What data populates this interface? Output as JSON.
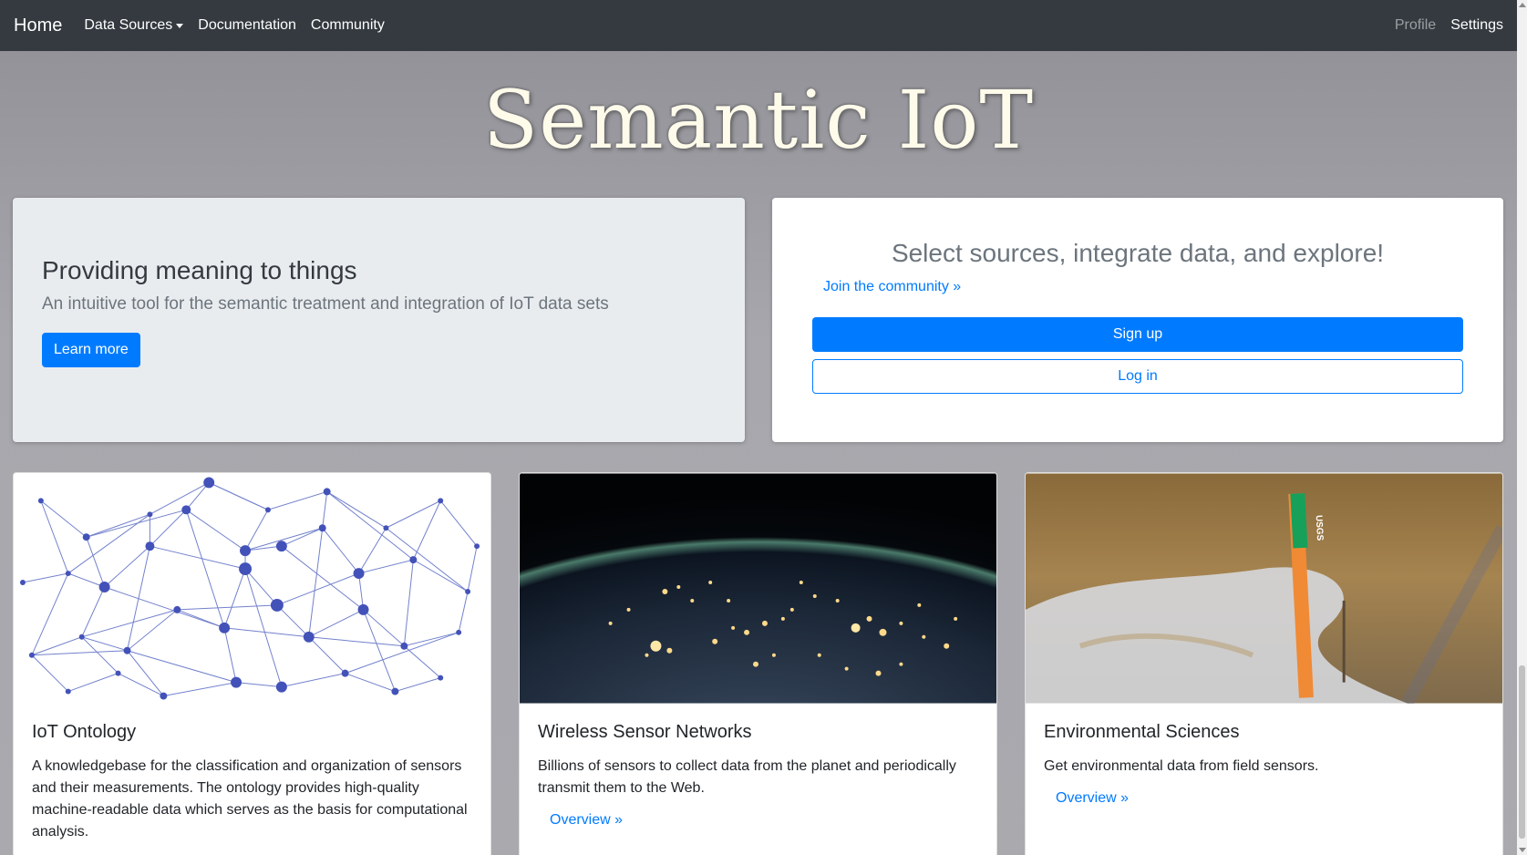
{
  "navbar": {
    "brand": "Home",
    "links": [
      "Data Sources",
      "Documentation",
      "Community"
    ],
    "right_links": [
      "Profile",
      "Settings"
    ]
  },
  "hero": {
    "title": "Semantic IoT"
  },
  "left_panel": {
    "heading": "Providing meaning to things",
    "lead": "An intuitive tool for the semantic treatment and integration of IoT data sets",
    "button": "Learn more"
  },
  "right_panel": {
    "heading": "Select sources, integrate data, and explore!",
    "join_link": "Join the community »",
    "signup": "Sign up",
    "login": "Log in"
  },
  "cards": [
    {
      "title": "IoT Ontology",
      "text": "A knowledgebase for the classification and organization of sensors and their measurements. The ontology provides high-quality machine-readable data which serves as the basis for computational analysis."
    },
    {
      "title": "Wireless Sensor Networks",
      "text": "Billions of sensors to collect data from the planet and periodically transmit them to the Web.",
      "link": "Overview »"
    },
    {
      "title": "Environmental Sciences",
      "text": "Get environmental data from field sensors.",
      "link": "Overview »",
      "image_label": "USGS"
    }
  ],
  "colors": {
    "navbar_bg": "#343a40",
    "primary": "#007bff",
    "panel_bg": "#e9ecef"
  }
}
